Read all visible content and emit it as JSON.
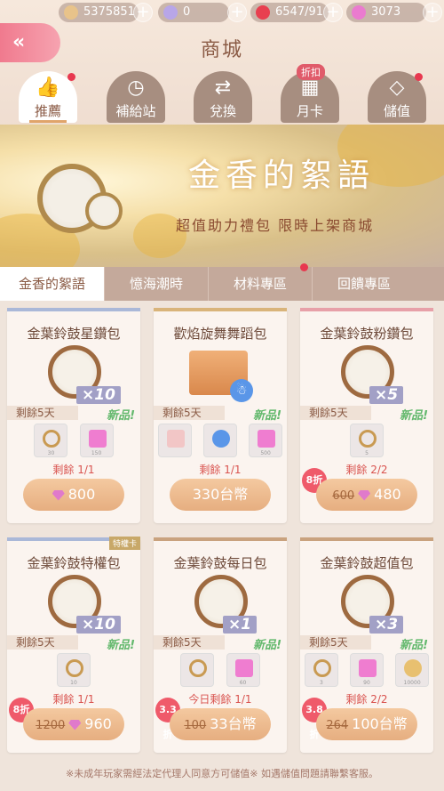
{
  "topbar": {
    "gold": "5375851",
    "diamond": "0",
    "stamina": "6547/91",
    "pinkgem": "3073"
  },
  "header": {
    "title": "商城",
    "back": "«"
  },
  "nav": [
    {
      "label": "推薦",
      "active": true
    },
    {
      "label": "補給站"
    },
    {
      "label": "兌換"
    },
    {
      "label": "月卡",
      "sale": "折扣"
    },
    {
      "label": "儲值"
    }
  ],
  "banner": {
    "title": "金香的絮語",
    "subtitle": "超值助力禮包  限時上架商城"
  },
  "subtabs": [
    "金香的絮語",
    "憶海潮時",
    "材料專區",
    "回饋專區"
  ],
  "cards": [
    {
      "name": "金葉鈴鼓星鑽包",
      "qty": "×10",
      "remain": "剩餘5天",
      "new": "新品!",
      "items": [
        "30",
        "150"
      ],
      "limit": "剩餘 1/1",
      "price": "800",
      "old": "",
      "discount": ""
    },
    {
      "name": "歡焰旋舞舞蹈包",
      "qty": "",
      "remain": "剩餘5天",
      "new": "新品!",
      "items": [
        "",
        "",
        "500"
      ],
      "limit": "剩餘 1/1",
      "price": "330台幣",
      "old": "",
      "discount": ""
    },
    {
      "name": "金葉鈴鼓粉鑽包",
      "qty": "×5",
      "remain": "剩餘5天",
      "new": "新品!",
      "items": [
        "5"
      ],
      "limit": "剩餘 2/2",
      "price": "480",
      "old": "600",
      "discount": "8折"
    },
    {
      "name": "金葉鈴鼓特權包",
      "qty": "×10",
      "remain": "剩餘5天",
      "new": "新品!",
      "items": [
        "10"
      ],
      "limit": "剩餘 1/1",
      "price": "960",
      "old": "1200",
      "discount": "8折",
      "tag": "特權卡"
    },
    {
      "name": "金葉鈴鼓每日包",
      "qty": "×1",
      "remain": "剩餘5天",
      "new": "新品!",
      "items": [
        "",
        "60"
      ],
      "limit": "今日剩餘 1/1",
      "price": "33台幣",
      "old": "100",
      "discount": "3.3折"
    },
    {
      "name": "金葉鈴鼓超值包",
      "qty": "×3",
      "remain": "剩餘5天",
      "new": "新品!",
      "items": [
        "3",
        "90",
        "10000"
      ],
      "limit": "剩餘 2/2",
      "price": "100台幣",
      "old": "264",
      "discount": "3.8折"
    }
  ],
  "footer": "※未成年玩家需經法定代理人同意方可儲值※ 如遇儲值問題請聯繫客服。"
}
